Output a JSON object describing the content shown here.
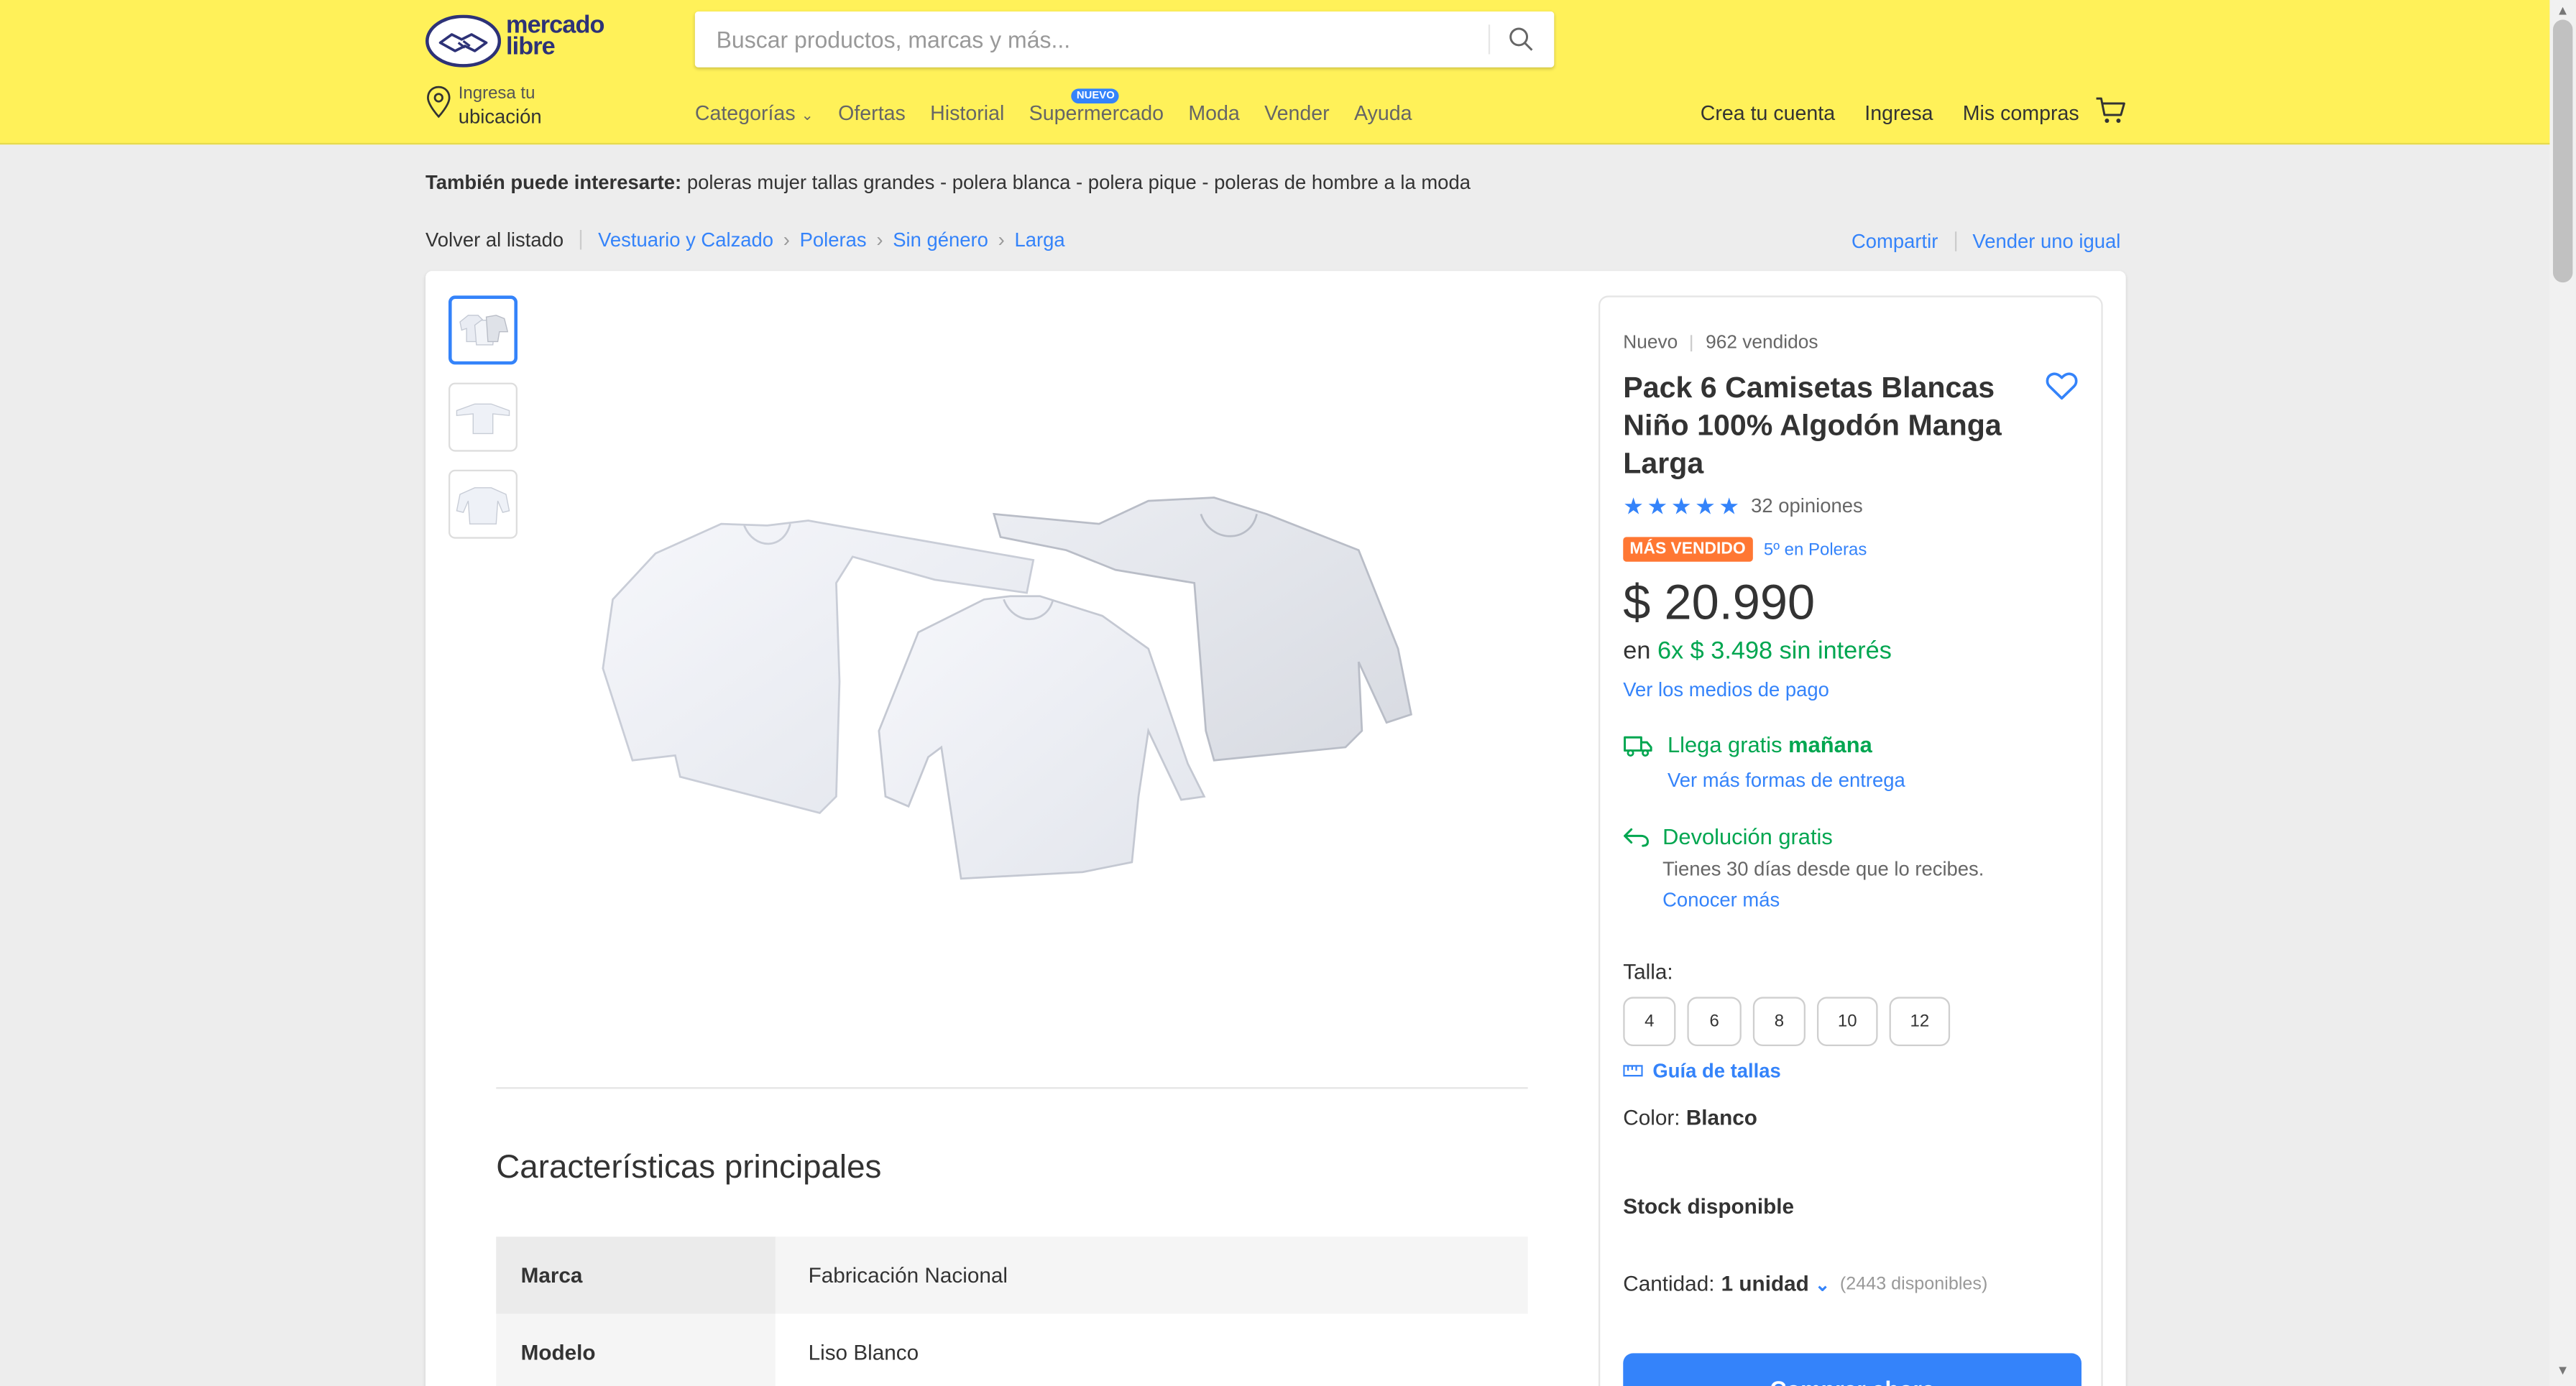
{
  "header": {
    "logo_text_line1": "mercado",
    "logo_text_line2": "libre",
    "search_placeholder": "Buscar productos, marcas y más...",
    "location_line1": "Ingresa tu",
    "location_line2": "ubicación",
    "nav": [
      {
        "label": "Categorías"
      },
      {
        "label": "Ofertas"
      },
      {
        "label": "Historial"
      },
      {
        "label": "Supermercado",
        "badge": "NUEVO"
      },
      {
        "label": "Moda"
      },
      {
        "label": "Vender"
      },
      {
        "label": "Ayuda"
      }
    ],
    "right_nav": [
      "Crea tu cuenta",
      "Ingresa",
      "Mis compras"
    ],
    "colors": {
      "brand_yellow": "#fff159",
      "accent_blue": "#3483fa"
    }
  },
  "suggestions": {
    "label": "También puede interesarte:",
    "items": "poleras mujer tallas grandes - polera blanca - polera pique - poleras de hombre a la moda"
  },
  "breadcrumb": {
    "back": "Volver al listado",
    "items": [
      "Vestuario y Calzado",
      "Poleras",
      "Sin género",
      "Larga"
    ],
    "share": "Compartir",
    "sell_same": "Vender uno igual"
  },
  "product": {
    "condition": "Nuevo",
    "sold": "962 vendidos",
    "title": "Pack 6 Camisetas Blancas Niño 100% Algodón Manga Larga",
    "rating": 5,
    "opinions": "32 opiniones",
    "badge": "MÁS VENDIDO",
    "rank": "5º en Poleras",
    "price": "$ 20.990",
    "installments_prefix": "en",
    "installments": "6x $ 3.498 sin interés",
    "pay_link": "Ver los medios de pago",
    "shipping_prefix": "Llega gratis",
    "shipping_day": "mañana",
    "shipping_link": "Ver más formas de entrega",
    "returns": "Devolución gratis",
    "returns_sub": "Tienes 30 días desde que lo recibes.",
    "returns_link": "Conocer más",
    "size_label": "Talla:",
    "sizes": [
      "4",
      "6",
      "8",
      "10",
      "12"
    ],
    "size_guide": "Guía de tallas",
    "color_label": "Color:",
    "color_value": "Blanco",
    "stock": "Stock disponible",
    "qty_label": "Cantidad:",
    "qty_value": "1 unidad",
    "qty_available": "(2443 disponibles)",
    "buy_button": "Comprar ahora"
  },
  "characteristics": {
    "title": "Características principales",
    "rows": [
      {
        "key": "Marca",
        "value": "Fabricación Nacional"
      },
      {
        "key": "Modelo",
        "value": "Liso Blanco"
      }
    ]
  }
}
